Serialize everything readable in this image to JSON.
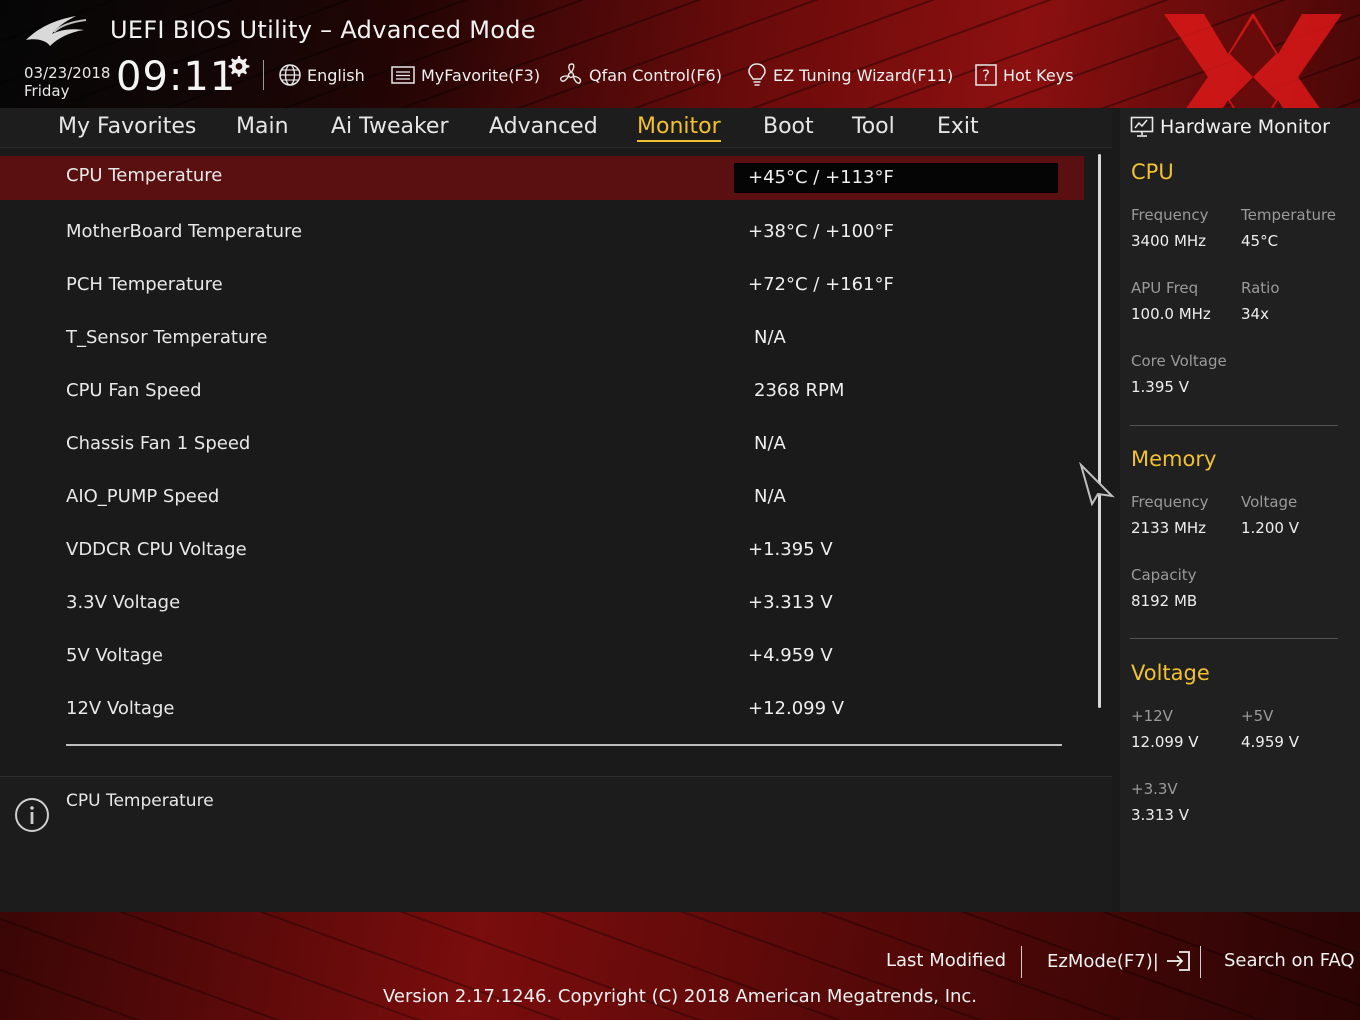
{
  "header": {
    "title": "UEFI BIOS Utility – Advanced Mode",
    "date": "03/23/2018",
    "day": "Friday",
    "time": "09:11",
    "toolbar": [
      {
        "label": "English",
        "icon": "globe-icon"
      },
      {
        "label": "MyFavorite(F3)",
        "icon": "favorite-list-icon"
      },
      {
        "label": "Qfan Control(F6)",
        "icon": "fan-icon"
      },
      {
        "label": "EZ Tuning Wizard(F11)",
        "icon": "lightbulb-icon"
      },
      {
        "label": "Hot Keys",
        "icon": "help-box-icon"
      }
    ]
  },
  "nav": {
    "tabs": [
      "My Favorites",
      "Main",
      "Ai Tweaker",
      "Advanced",
      "Monitor",
      "Boot",
      "Tool",
      "Exit"
    ],
    "active": "Monitor"
  },
  "monitor": {
    "rows": [
      {
        "label": "CPU Temperature",
        "value": "+45°C / +113°F"
      },
      {
        "label": "MotherBoard Temperature",
        "value": "+38°C / +100°F"
      },
      {
        "label": "PCH Temperature",
        "value": "+72°C / +161°F"
      },
      {
        "label": "T_Sensor Temperature",
        "value": "N/A"
      },
      {
        "label": "CPU Fan Speed",
        "value": "2368 RPM"
      },
      {
        "label": "Chassis Fan 1 Speed",
        "value": "N/A"
      },
      {
        "label": "AIO_PUMP Speed",
        "value": "N/A"
      },
      {
        "label": "VDDCR CPU Voltage",
        "value": "+1.395 V"
      },
      {
        "label": "3.3V Voltage",
        "value": "+3.313 V"
      },
      {
        "label": "5V Voltage",
        "value": "+4.959 V"
      },
      {
        "label": "12V Voltage",
        "value": "+12.099 V"
      }
    ]
  },
  "help": {
    "text": "CPU Temperature"
  },
  "hardware_monitor": {
    "title": "Hardware Monitor",
    "cpu": {
      "section": "CPU",
      "frequency_label": "Frequency",
      "frequency": "3400 MHz",
      "temperature_label": "Temperature",
      "temperature": "45°C",
      "apu_label": "APU Freq",
      "apu": "100.0 MHz",
      "ratio_label": "Ratio",
      "ratio": "34x",
      "core_voltage_label": "Core Voltage",
      "core_voltage": "1.395 V"
    },
    "memory": {
      "section": "Memory",
      "frequency_label": "Frequency",
      "frequency": "2133 MHz",
      "voltage_label": "Voltage",
      "voltage": "1.200 V",
      "capacity_label": "Capacity",
      "capacity": "8192 MB"
    },
    "voltage": {
      "section": "Voltage",
      "v12_label": "+12V",
      "v12": "12.099 V",
      "v5_label": "+5V",
      "v5": "4.959 V",
      "v33_label": "+3.3V",
      "v33": "3.313 V"
    }
  },
  "footer": {
    "last_modified": "Last Modified",
    "ezmode": "EzMode(F7)|",
    "search_faq": "Search on FAQ",
    "version": "Version 2.17.1246. Copyright (C) 2018 American Megatrends, Inc."
  },
  "colors": {
    "accent": "#f2c131",
    "selected_row": "#5a1010",
    "watermark": "#e01818"
  }
}
